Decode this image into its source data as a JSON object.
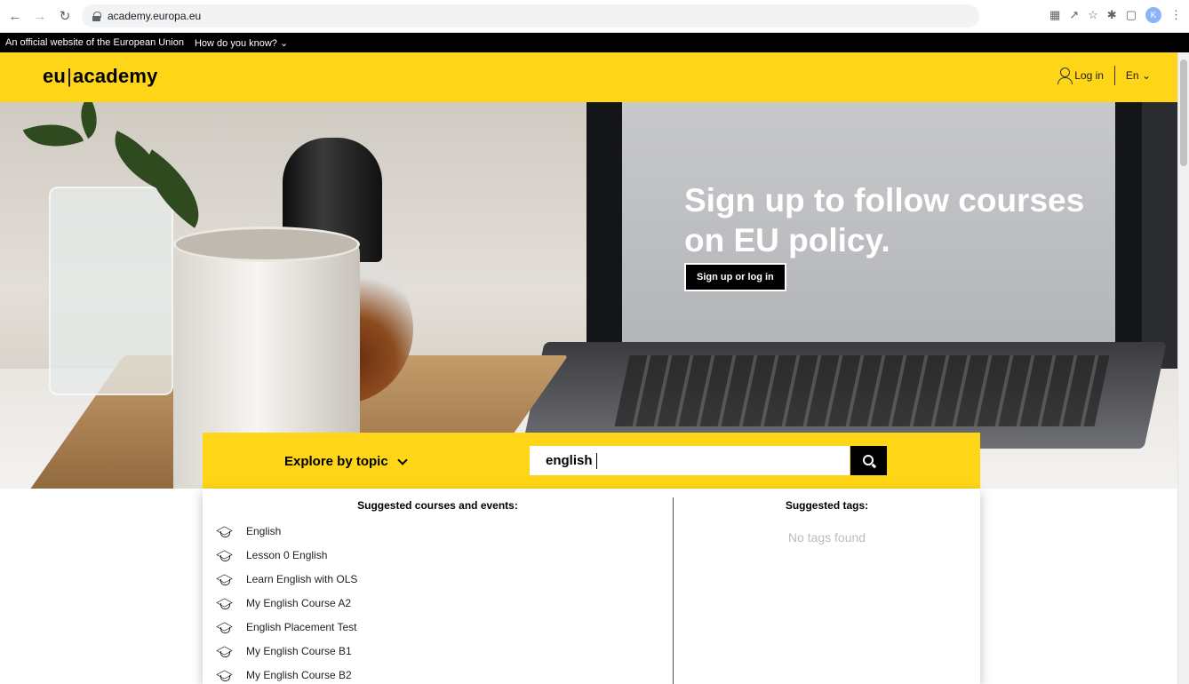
{
  "browser": {
    "url": "academy.europa.eu",
    "profile_initial": "K",
    "icons": [
      "back-icon",
      "forward-icon",
      "reload-icon",
      "lock-icon",
      "translate-icon",
      "share-icon",
      "star-icon",
      "extensions-icon",
      "sidepanel-icon",
      "avatar",
      "menu-icon"
    ]
  },
  "eu_banner": {
    "official_text": "An official website of the European Union",
    "how_text": "How do you know?"
  },
  "header": {
    "logo_left": "eu",
    "logo_right": "academy",
    "login_label": "Log in",
    "language": "En",
    "brand_color": "#ffd617"
  },
  "hero": {
    "title": "Sign up to follow courses on EU policy.",
    "cta_label": "Sign up or log in"
  },
  "search": {
    "explore_label": "Explore by topic",
    "query": "english"
  },
  "suggestions": {
    "courses_heading": "Suggested courses and events:",
    "courses": [
      "English",
      "Lesson 0 English",
      "Learn English with OLS",
      "My English Course A2",
      "English Placement Test",
      "My English Course B1",
      "My English Course B2"
    ],
    "tags_heading": "Suggested tags:",
    "no_tags": "No tags found"
  }
}
